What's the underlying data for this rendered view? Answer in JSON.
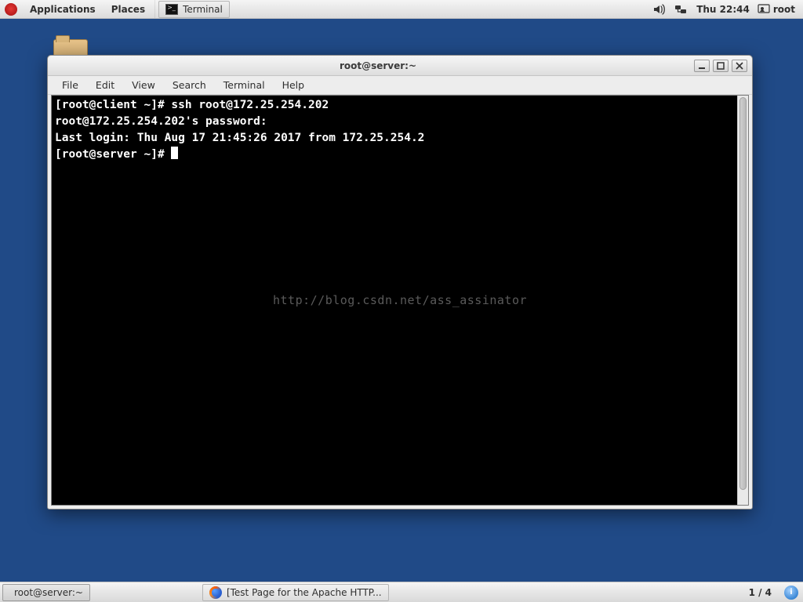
{
  "top_panel": {
    "applications": "Applications",
    "places": "Places",
    "task_terminal": "Terminal",
    "clock": "Thu 22:44",
    "user": "root"
  },
  "window": {
    "title": "root@server:~",
    "menus": {
      "file": "File",
      "edit": "Edit",
      "view": "View",
      "search": "Search",
      "terminal": "Terminal",
      "help": "Help"
    }
  },
  "terminal": {
    "line1_prompt": "[root@client ~]# ",
    "line1_cmd": "ssh root@172.25.254.202",
    "line2": "root@172.25.254.202's password: ",
    "line3": "Last login: Thu Aug 17 21:45:26 2017 from 172.25.254.2",
    "line4_prompt": "[root@server ~]# "
  },
  "watermark": "http://blog.csdn.net/ass_assinator",
  "bottom_panel": {
    "task_terminal": "root@server:~",
    "task_firefox": "[Test Page for the Apache HTTP...",
    "workspace": "1 / 4",
    "info_badge": "i"
  }
}
